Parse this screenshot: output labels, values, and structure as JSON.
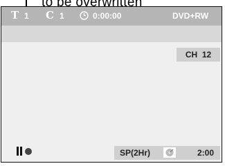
{
  "callout": {
    "text": "to be overwritten"
  },
  "status_bar": {
    "title_symbol": "T",
    "title_number": "1",
    "chapter_symbol": "C",
    "chapter_number": "1",
    "elapsed_time": "0:00:00",
    "disc_type": "DVD+RW"
  },
  "channel": {
    "label": "CH",
    "number": "12"
  },
  "footer": {
    "record_mode": "SP(2Hr)",
    "remaining_time": "2:00"
  },
  "colors": {
    "bar": "#b5b5b5",
    "screen": "#efefef",
    "badge": "#cfcfcf"
  }
}
